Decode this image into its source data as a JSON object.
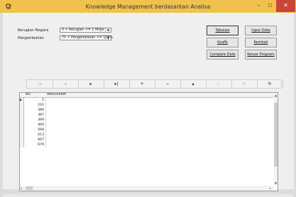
{
  "window": {
    "title": "Knowledge Management berdasarkan Analisa"
  },
  "filters": {
    "kerugian_label": "Kerugian Negara",
    "kerugian_value": "0 < Kerugian <= 1 Miljar",
    "pengembalian_label": "Pengembalian",
    "pengembalian_value": "75 < Pengembalian <= 100%"
  },
  "buttons": {
    "tabulasi": "Tabulasi",
    "input_data": "Input Data",
    "grafik": "Grafik",
    "kembali": "Kembali",
    "compare_data": "Compare Data",
    "keluar_program": "Keluar Program"
  },
  "navigator": [
    {
      "name": "nav-first-button",
      "glyph": "|◂",
      "enabled": false
    },
    {
      "name": "nav-prior-button",
      "glyph": "◂",
      "enabled": false
    },
    {
      "name": "nav-next-button",
      "glyph": "▸",
      "enabled": true
    },
    {
      "name": "nav-last-button",
      "glyph": "▸|",
      "enabled": true
    },
    {
      "name": "nav-insert-button",
      "glyph": "+",
      "enabled": true
    },
    {
      "name": "nav-delete-button",
      "glyph": "−",
      "enabled": true
    },
    {
      "name": "nav-edit-button",
      "glyph": "▴",
      "enabled": true
    },
    {
      "name": "nav-post-button",
      "glyph": "✓",
      "enabled": false
    },
    {
      "name": "nav-cancel-button",
      "glyph": "✕",
      "enabled": false
    },
    {
      "name": "nav-refresh-button",
      "glyph": "↻",
      "enabled": true
    }
  ],
  "grid": {
    "columns": [
      "NO",
      "ANALISAKM"
    ],
    "rows": [
      "2",
      "210",
      "386",
      "387",
      "399",
      "400",
      "568",
      "613",
      "667",
      "679"
    ]
  },
  "colors": {
    "titlebar": "#f0c14d",
    "close": "#c9453a"
  }
}
